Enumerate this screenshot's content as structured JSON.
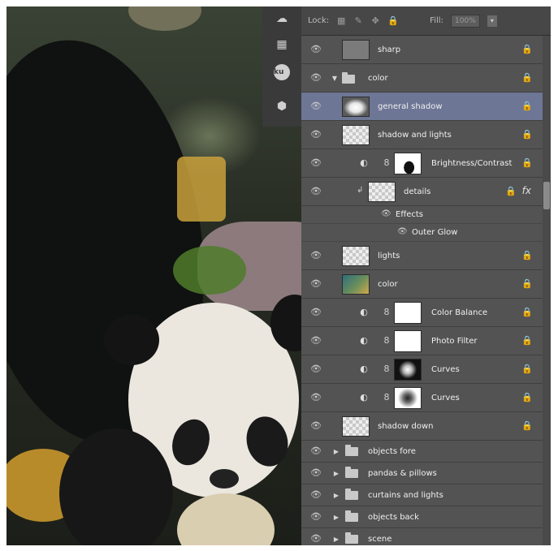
{
  "lock_bar": {
    "lock_label": "Lock:",
    "fill_label": "Fill:",
    "fill_value": "100%"
  },
  "toolstrip": {
    "icons": [
      "3d-icon",
      "swatches-icon",
      "kuler-icon",
      "3d-cube-icon"
    ],
    "kuler_label": "ku"
  },
  "layers": [
    {
      "name": "sharp",
      "type": "layer",
      "thumb": "gray",
      "locked": true
    },
    {
      "name": "color",
      "type": "group",
      "expanded": true,
      "locked": true
    },
    {
      "name": "general shadow",
      "type": "layer",
      "thumb": "white-glow",
      "selected": true,
      "locked": false
    },
    {
      "name": "shadow and lights",
      "type": "layer",
      "thumb": "checker",
      "locked": false
    },
    {
      "name": "Brightness/Contrast",
      "type": "adjustment",
      "mask": "silhouette",
      "locked": false
    },
    {
      "name": "details",
      "type": "layer",
      "thumb": "checker",
      "clipped": true,
      "fx": true,
      "locked": false
    },
    {
      "name": "Effects",
      "type": "effects-header"
    },
    {
      "name": "Outer Glow",
      "type": "effect"
    },
    {
      "name": "lights",
      "type": "layer",
      "thumb": "checker",
      "locked": false
    },
    {
      "name": "color",
      "type": "layer",
      "thumb": "color-gradient",
      "locked": false
    },
    {
      "name": "Color Balance",
      "type": "adjustment",
      "mask": "white",
      "locked": false
    },
    {
      "name": "Photo Filter",
      "type": "adjustment",
      "mask": "white",
      "locked": false
    },
    {
      "name": "Curves",
      "type": "adjustment",
      "mask": "radial-dark",
      "locked": false
    },
    {
      "name": "Curves",
      "type": "adjustment",
      "mask": "radial-light",
      "locked": false
    },
    {
      "name": "shadow down",
      "type": "layer",
      "thumb": "checker",
      "locked": false
    },
    {
      "name": "objects fore",
      "type": "group",
      "expanded": false
    },
    {
      "name": "pandas & pillows",
      "type": "group",
      "expanded": false
    },
    {
      "name": "curtains and lights",
      "type": "group",
      "expanded": false
    },
    {
      "name": "objects back",
      "type": "group",
      "expanded": false
    },
    {
      "name": "scene",
      "type": "group",
      "expanded": false
    }
  ],
  "glyphs": {
    "eye": "👁",
    "lock": "🔒",
    "fx": "fx",
    "chain": "8",
    "adj": "◐",
    "arrow_open": "▼",
    "arrow_closed": "▶",
    "clip": "↲",
    "dropdown": "▾"
  },
  "colors": {
    "panel": "#535353",
    "selected_row": "#6d7695",
    "canvas_dark": "#1c1f19"
  }
}
